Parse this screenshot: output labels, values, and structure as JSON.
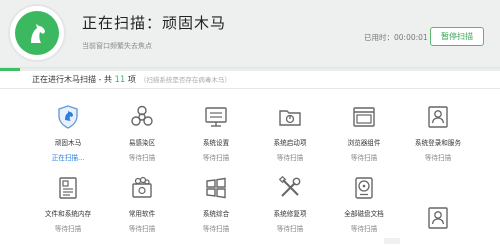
{
  "header": {
    "title": "正在扫描：顽固木马",
    "subtitle": "当前窗口频繁失去焦点",
    "elapsed_label": "已用时：00:00:01",
    "pause_button": "暂停扫描",
    "accent_color": "#3cb861",
    "icon": "horse-icon"
  },
  "progress": {
    "value": 0.04
  },
  "status": {
    "prefix": "正在进行木马扫描 - 共 ",
    "count": "11",
    "suffix": " 项",
    "hint": "（扫描系统是否存在病毒木马）"
  },
  "items": [
    {
      "label": "顽固木马",
      "state": "正在扫描...",
      "icon": "shield-icon"
    },
    {
      "label": "易感染区",
      "state": "等待扫描",
      "icon": "biohazard-icon"
    },
    {
      "label": "系统设置",
      "state": "等待扫描",
      "icon": "monitor-settings-icon"
    },
    {
      "label": "系统启动项",
      "state": "等待扫描",
      "icon": "startup-folder-icon"
    },
    {
      "label": "浏览器组件",
      "state": "等待扫描",
      "icon": "browser-icon"
    },
    {
      "label": "系统登录和服务",
      "state": "等待扫描",
      "icon": "user-login-icon"
    },
    {
      "label": "文件和系统内存",
      "state": "等待扫描",
      "icon": "document-icon"
    },
    {
      "label": "常用软件",
      "state": "等待扫描",
      "icon": "software-icon"
    },
    {
      "label": "系统综合",
      "state": "等待扫描",
      "icon": "windows-icon"
    },
    {
      "label": "系统修复项",
      "state": "等待扫描",
      "icon": "tools-icon"
    },
    {
      "label": "全部磁盘文档",
      "state": "等待扫描",
      "icon": "disk-icon"
    },
    {
      "label": "",
      "state": "",
      "icon": "user-login-icon"
    }
  ]
}
